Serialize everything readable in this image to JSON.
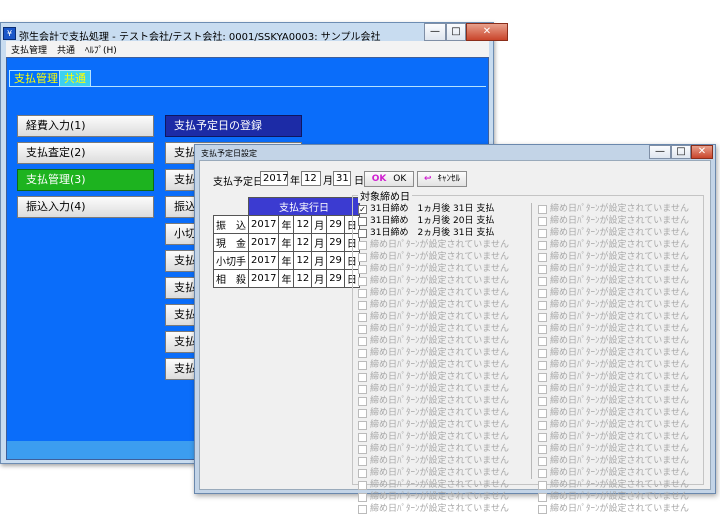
{
  "main": {
    "title": "弥生会計で支払処理 - テスト会社/テスト会社: 0001/SSKYA0003: サンプル会社",
    "caption_min": "—",
    "caption_max": "□",
    "caption_close": "✕",
    "menu": [
      "支払管理",
      "共通",
      "ﾍﾙﾌﾟ(H)"
    ],
    "tabs": [
      "支払管理",
      "共通"
    ],
    "left_buttons": [
      "経費入力(1)",
      "支払査定(2)",
      "支払管理(3)",
      "振込入力(4)"
    ],
    "right_buttons": [
      "支払予定日の登録",
      "支払業務進捗確認",
      "支払",
      "振込",
      "小切",
      "支払",
      "支払",
      "支払",
      "支払",
      "支払"
    ]
  },
  "dialog": {
    "title": "支払予定日設定",
    "pay_date_label": "支払予定日",
    "pay_date": {
      "year": "2017",
      "year_unit": "年",
      "month": "12",
      "month_unit": "月",
      "day": "31",
      "day_unit": "日"
    },
    "ok_icon": "OK",
    "ok_label": "OK",
    "cancel_label": "ｷｬﾝｾﾙ",
    "cancel_icon": "↩",
    "table_header": "支払実行日",
    "rows": [
      {
        "label": "振　込",
        "year": "2017",
        "month": "12",
        "day": "29"
      },
      {
        "label": "現　金",
        "year": "2017",
        "month": "12",
        "day": "29"
      },
      {
        "label": "小切手",
        "year": "2017",
        "month": "12",
        "day": "29"
      },
      {
        "label": "相　殺",
        "year": "2017",
        "month": "12",
        "day": "29"
      }
    ],
    "units": {
      "year": "年",
      "month": "月",
      "day": "日"
    },
    "group_label": "対象締め日",
    "closing_items": [
      {
        "label": "31日締め　1ヵ月後 31日 支払",
        "checked": true
      },
      {
        "label": "31日締め　1ヵ月後 20日 支払",
        "checked": false
      },
      {
        "label": "31日締め　2ヵ月後 31日 支払",
        "checked": false
      }
    ],
    "disabled_label": "締め日ﾊﾟﾀｰﾝが設定されていません",
    "check_mark": "✓"
  }
}
